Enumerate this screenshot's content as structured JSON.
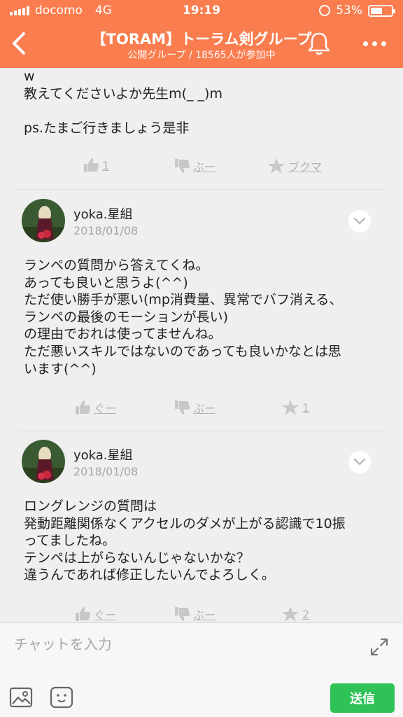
{
  "status": {
    "carrier": "docomo",
    "network": "4G",
    "time": "19:19",
    "battery": "53%"
  },
  "header": {
    "title": "【TORAM】トーラム剣グループ",
    "subtitle": "公開グループ / 18565人が参加中"
  },
  "post0": {
    "text": "w\n教えてくださいよか先生m(_ _)m\n\nps.たまご行きましょう是非",
    "like": "1",
    "dislike": "ぶー",
    "bookmark": "ブクマ"
  },
  "post1": {
    "user": "yoka.星組",
    "date": "2018/01/08",
    "text": "ランペの質問から答えてくね。\nあっても良いと思うよ(^^)\nただ使い勝手が悪い(mp消費量、異常でバフ消える、\nランペの最後のモーションが長い)\nの理由でおれは使ってませんね。\nただ悪いスキルではないのであっても良いかなとは思\nいます(^^)",
    "like": "ぐー",
    "dislike": "ぶー",
    "star": "1"
  },
  "post2": {
    "user": "yoka.星組",
    "date": "2018/01/08",
    "text": "ロングレンジの質問は\n発動距離関係なくアクセルのダメが上がる認識で10振\nってましたね。\nテンペは上がらないんじゃないかな？\n違うんであれば修正したいんでよろしく。",
    "like": "ぐー",
    "dislike": "ぶー",
    "star": "2"
  },
  "chat": {
    "placeholder": "チャットを入力",
    "send": "送信"
  },
  "colors": {
    "header": "#f97d4f",
    "send": "#2ec257",
    "muted": "#b4b4b4"
  },
  "icons": [
    "back-icon",
    "bell-icon",
    "more-icon",
    "thumbs-up-icon",
    "thumbs-down-icon",
    "star-icon",
    "chevron-down-icon",
    "expand-icon",
    "image-icon",
    "emoji-icon"
  ]
}
